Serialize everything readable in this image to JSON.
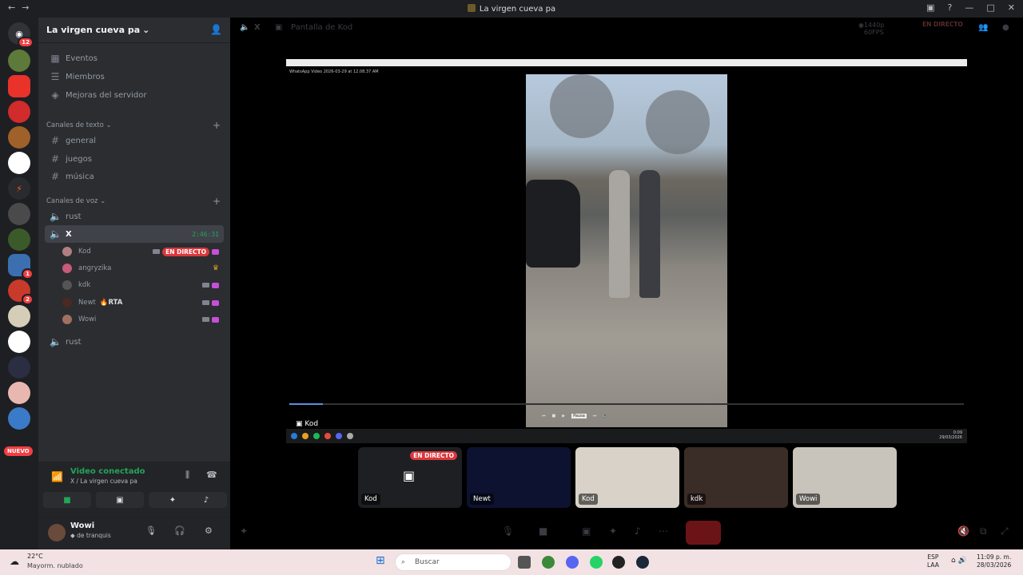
{
  "window": {
    "title": "La virgen cueva pa"
  },
  "server": {
    "name": "La virgen cueva pa"
  },
  "nav": [
    {
      "label": "Eventos",
      "icon": "calendar-icon"
    },
    {
      "label": "Miembros",
      "icon": "members-icon"
    },
    {
      "label": "Mejoras del servidor",
      "icon": "boost-icon"
    }
  ],
  "text_category": {
    "label": "Canales de texto"
  },
  "text_channels": [
    {
      "label": "general"
    },
    {
      "label": "juegos"
    },
    {
      "label": "música"
    }
  ],
  "voice_category": {
    "label": "Canales de voz"
  },
  "voice_channels": {
    "rust1": "rust",
    "x": "X",
    "x_time": "2:46:31",
    "rust2": "rust"
  },
  "voice_users": [
    {
      "name": "Kod",
      "live": "EN DIRECTO"
    },
    {
      "name": "angryzika"
    },
    {
      "name": "kdk"
    },
    {
      "name": "Newt",
      "tag": "RTA"
    },
    {
      "name": "Wowi"
    }
  ],
  "guild_badges": {
    "home": "12",
    "g10": "1",
    "g11": "2",
    "nuevo": "NUEVO"
  },
  "voice_panel": {
    "status": "Video conectado",
    "sub": "X / La virgen cueva pa"
  },
  "user": {
    "name": "Wowi",
    "status": "de tranquis"
  },
  "stage_top": {
    "channel": "X",
    "stream": "Pantalla de Kod",
    "quality": "1440p 60FPS",
    "live": "EN DIRECTO"
  },
  "stream": {
    "file": "WhatsApp Video 2026-03-29 at 12.08.37 AM",
    "overlay_name": "Kod",
    "pause": "Pausa",
    "clock_time": "0:09",
    "clock_date": "29/03/2026"
  },
  "tiles": [
    {
      "name": "Kod",
      "live": "EN DIRECTO",
      "color": "#1e1f22"
    },
    {
      "name": "Newt",
      "color": "#0c1230"
    },
    {
      "name": "Kod",
      "color": "#d8d2c8"
    },
    {
      "name": "kdk",
      "color": "#3a2c26"
    },
    {
      "name": "Wowi",
      "color": "#c9c4bb"
    }
  ],
  "taskbar": {
    "temp": "22°C",
    "weather": "Mayorm. nublado",
    "search": "Buscar",
    "lang1": "ESP",
    "lang2": "LAA",
    "time": "11:09 p. m.",
    "date": "28/03/2026"
  }
}
